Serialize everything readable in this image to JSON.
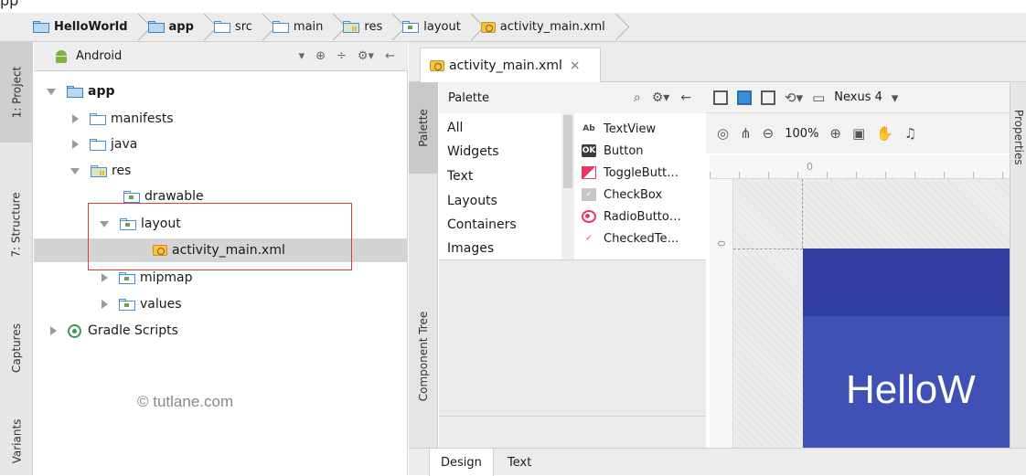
{
  "top_crop_text": "pp",
  "breadcrumb": [
    {
      "label": "HelloWorld",
      "icon": "module-folder-icon",
      "bold": true
    },
    {
      "label": "app",
      "icon": "module-folder-icon",
      "bold": true
    },
    {
      "label": "src",
      "icon": "folder-icon",
      "bold": false
    },
    {
      "label": "main",
      "icon": "folder-icon",
      "bold": false
    },
    {
      "label": "res",
      "icon": "res-folder-icon",
      "bold": false
    },
    {
      "label": "layout",
      "icon": "package-folder-icon",
      "bold": false
    },
    {
      "label": "activity_main.xml",
      "icon": "xml-file-icon",
      "bold": false
    }
  ],
  "left_tool_tabs": [
    "1: Project",
    "7: Structure",
    "Captures",
    "Variants"
  ],
  "project_panel": {
    "view_selector": "Android",
    "tools": [
      "⊕",
      "÷",
      "⚙▾",
      "←"
    ],
    "tree": [
      {
        "label": "app",
        "level": 0,
        "expanded": true,
        "icon": "module-folder-icon",
        "bold": true
      },
      {
        "label": "manifests",
        "level": 1,
        "expanded": false,
        "icon": "folder-icon"
      },
      {
        "label": "java",
        "level": 1,
        "expanded": false,
        "icon": "folder-icon"
      },
      {
        "label": "res",
        "level": 1,
        "expanded": true,
        "icon": "res-folder-icon"
      },
      {
        "label": "drawable",
        "level": 2,
        "expanded": null,
        "icon": "package-folder-icon"
      },
      {
        "label": "layout",
        "level": 2,
        "expanded": true,
        "icon": "package-folder-icon"
      },
      {
        "label": "activity_main.xml",
        "level": 3,
        "expanded": null,
        "icon": "xml-file-icon",
        "selected": true
      },
      {
        "label": "mipmap",
        "level": 2,
        "expanded": false,
        "icon": "package-folder-icon"
      },
      {
        "label": "values",
        "level": 2,
        "expanded": false,
        "icon": "package-folder-icon"
      },
      {
        "label": "Gradle Scripts",
        "level": 0,
        "expanded": false,
        "icon": "gradle-icon"
      }
    ],
    "watermark": "© tutlane.com"
  },
  "editor": {
    "tab_label": "activity_main.xml",
    "tab_close": "×",
    "side_tabs": [
      "Palette",
      "Component Tree"
    ],
    "palette": {
      "title": "Palette",
      "tools": [
        "⌕",
        "⚙▾",
        "←"
      ],
      "categories": [
        "All",
        "Widgets",
        "Text",
        "Layouts",
        "Containers",
        "Images"
      ],
      "items": [
        {
          "label": "TextView",
          "icon": "textview-icon",
          "glyph": "Ab"
        },
        {
          "label": "Button",
          "icon": "button-icon",
          "glyph": "OK"
        },
        {
          "label": "ToggleButt…",
          "icon": "togglebutton-icon",
          "glyph": ""
        },
        {
          "label": "CheckBox",
          "icon": "checkbox-icon",
          "glyph": "✓"
        },
        {
          "label": "RadioButto…",
          "icon": "radiobutton-icon",
          "glyph": ""
        },
        {
          "label": "CheckedTe…",
          "icon": "checkedtextview-icon",
          "glyph": "✓"
        }
      ]
    },
    "design_toolbar": {
      "device": "Nexus 4",
      "zoom": "100%",
      "ruler_tick_label": "0"
    },
    "preview_text": "HelloW",
    "bottom_tabs": [
      "Design",
      "Text"
    ],
    "right_tab": "Properties"
  },
  "colors": {
    "app_bar": "#303f9f",
    "app_body": "#3f51b5",
    "highlight_box": "#e8343e"
  }
}
